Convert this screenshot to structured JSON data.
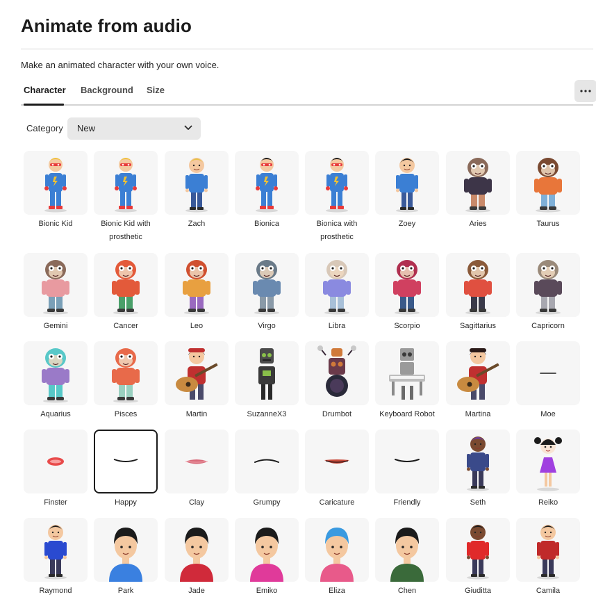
{
  "header": {
    "title": "Animate from audio",
    "subtitle": "Make an animated character with your own voice."
  },
  "tabs": [
    {
      "label": "Character",
      "selected": true
    },
    {
      "label": "Background",
      "selected": false
    },
    {
      "label": "Size",
      "selected": false
    }
  ],
  "more_icon": "ellipsis-icon",
  "category": {
    "label": "Category",
    "value": "New",
    "icon": "chevron-down-icon"
  },
  "characters": [
    {
      "name": "Bionic Kid",
      "kind": "hero",
      "colors": {
        "main": "#3b7fd4",
        "accent": "#e83a3a",
        "hair": "#f0c23a"
      }
    },
    {
      "name": "Bionic Kid with prosthetic",
      "kind": "hero",
      "colors": {
        "main": "#3b7fd4",
        "accent": "#e83a3a",
        "hair": "#f0c23a"
      }
    },
    {
      "name": "Zach",
      "kind": "person",
      "colors": {
        "main": "#3b7fd4",
        "accent": "#f2c230",
        "hair": "#e8c04a"
      }
    },
    {
      "name": "Bionica",
      "kind": "hero",
      "colors": {
        "main": "#3b7fd4",
        "accent": "#e83a3a",
        "hair": "#1b1b1b"
      }
    },
    {
      "name": "Bionica with prosthetic",
      "kind": "hero",
      "colors": {
        "main": "#3b7fd4",
        "accent": "#e83a3a",
        "hair": "#1b1b1b"
      }
    },
    {
      "name": "Zoey",
      "kind": "person",
      "colors": {
        "main": "#3b7fd4",
        "accent": "#f2c230",
        "hair": "#1b1b1b"
      }
    },
    {
      "name": "Aries",
      "kind": "creature",
      "colors": {
        "main": "#3d3548",
        "accent": "#c98a6a",
        "hair": "#8a6a5a"
      }
    },
    {
      "name": "Taurus",
      "kind": "creature",
      "colors": {
        "main": "#e8763a",
        "accent": "#7fb0d8",
        "hair": "#7a4a32"
      }
    },
    {
      "name": "Gemini",
      "kind": "creature",
      "colors": {
        "main": "#e89aa0",
        "accent": "#7aa0b8",
        "hair": "#8a6a5a"
      }
    },
    {
      "name": "Cancer",
      "kind": "creature",
      "colors": {
        "main": "#e35a3a",
        "accent": "#4aa06a",
        "hair": "#e35a3a"
      }
    },
    {
      "name": "Leo",
      "kind": "creature",
      "colors": {
        "main": "#e8a040",
        "accent": "#9a6ac0",
        "hair": "#d05030"
      }
    },
    {
      "name": "Virgo",
      "kind": "creature",
      "colors": {
        "main": "#6a8ab0",
        "accent": "#8a9aa8",
        "hair": "#6a7a88"
      }
    },
    {
      "name": "Libra",
      "kind": "creature",
      "colors": {
        "main": "#8a8ae0",
        "accent": "#a8c0d8",
        "hair": "#d8c8b8"
      }
    },
    {
      "name": "Scorpio",
      "kind": "creature",
      "colors": {
        "main": "#d04060",
        "accent": "#3a5a8a",
        "hair": "#b03050"
      }
    },
    {
      "name": "Sagittarius",
      "kind": "creature",
      "colors": {
        "main": "#e05040",
        "accent": "#3a3a4a",
        "hair": "#8a5a3a"
      }
    },
    {
      "name": "Capricorn",
      "kind": "creature",
      "colors": {
        "main": "#5a4a5a",
        "accent": "#a8a8b0",
        "hair": "#9a8a7a"
      }
    },
    {
      "name": "Aquarius",
      "kind": "creature",
      "colors": {
        "main": "#9a7ac8",
        "accent": "#58c8c8",
        "hair": "#58c8c8"
      }
    },
    {
      "name": "Pisces",
      "kind": "creature",
      "colors": {
        "main": "#e86a4a",
        "accent": "#9ad0c0",
        "hair": "#e86a4a"
      }
    },
    {
      "name": "Martin",
      "kind": "guitar",
      "colors": {
        "main": "#c03030",
        "accent": "#c88a40",
        "hair": "#3a2a20"
      }
    },
    {
      "name": "SuzanneX3",
      "kind": "robot",
      "colors": {
        "main": "#3a3a3a",
        "accent": "#8ac04a",
        "hair": "#2a2a2a"
      }
    },
    {
      "name": "Drumbot",
      "kind": "drumbot",
      "colors": {
        "main": "#6a3a4a",
        "accent": "#d07a3a",
        "hair": "#3a2a3a"
      }
    },
    {
      "name": "Keyboard Robot",
      "kind": "keyboardbot",
      "colors": {
        "main": "#9a9a9a",
        "accent": "#6a6a6a",
        "hair": "#5a5a5a"
      }
    },
    {
      "name": "Martina",
      "kind": "guitar",
      "colors": {
        "main": "#c03030",
        "accent": "#c88a40",
        "hair": "#2a1a18"
      }
    },
    {
      "name": "Moe",
      "kind": "mouth-flat",
      "colors": {
        "main": "#1b1b1b",
        "accent": "#1b1b1b",
        "hair": "#1b1b1b"
      }
    },
    {
      "name": "Finster",
      "kind": "mouth-red",
      "colors": {
        "main": "#e84a4a",
        "accent": "#f8a0a0",
        "hair": "#e84a4a"
      }
    },
    {
      "name": "Happy",
      "kind": "mouth-smile",
      "colors": {
        "main": "#1b1b1b",
        "accent": "#1b1b1b",
        "hair": "#1b1b1b"
      },
      "selected": true
    },
    {
      "name": "Clay",
      "kind": "mouth-lips",
      "colors": {
        "main": "#d86a7a",
        "accent": "#f0a8b0",
        "hair": "#d86a7a"
      }
    },
    {
      "name": "Grumpy",
      "kind": "mouth-frown",
      "colors": {
        "main": "#1b1b1b",
        "accent": "#1b1b1b",
        "hair": "#1b1b1b"
      }
    },
    {
      "name": "Caricature",
      "kind": "mouth-caricature",
      "colors": {
        "main": "#c84a3a",
        "accent": "#3a1a1a",
        "hair": "#c84a3a"
      }
    },
    {
      "name": "Friendly",
      "kind": "mouth-smile",
      "colors": {
        "main": "#1b1b1b",
        "accent": "#1b1b1b",
        "hair": "#1b1b1b"
      }
    },
    {
      "name": "Seth",
      "kind": "person",
      "colors": {
        "main": "#3a4a8a",
        "accent": "#5a5a9a",
        "hair": "#6a3ab0",
        "skin": "#7a4a30"
      }
    },
    {
      "name": "Reiko",
      "kind": "girl",
      "colors": {
        "main": "#a040e0",
        "accent": "#f4f4f4",
        "hair": "#1b1b1b"
      }
    },
    {
      "name": "Raymond",
      "kind": "person",
      "colors": {
        "main": "#2a4ad0",
        "accent": "#5ad05a",
        "hair": "#1b1b1b"
      }
    },
    {
      "name": "Park",
      "kind": "bust",
      "colors": {
        "main": "#3a80e0",
        "accent": "#3a80e0",
        "hair": "#1b1b1b"
      }
    },
    {
      "name": "Jade",
      "kind": "bust",
      "colors": {
        "main": "#d02a3a",
        "accent": "#2a2a2a",
        "hair": "#1b1b1b"
      }
    },
    {
      "name": "Emiko",
      "kind": "bust",
      "colors": {
        "main": "#e03a9a",
        "accent": "#f4f4f4",
        "hair": "#1b1b1b"
      }
    },
    {
      "name": "Eliza",
      "kind": "bust",
      "colors": {
        "main": "#e85a8a",
        "accent": "#f4f4f4",
        "hair": "#3a9ae0"
      }
    },
    {
      "name": "Chen",
      "kind": "bust",
      "colors": {
        "main": "#3a6a3a",
        "accent": "#6a9a5a",
        "hair": "#1b1b1b"
      }
    },
    {
      "name": "Giuditta",
      "kind": "person",
      "colors": {
        "main": "#e02a2a",
        "accent": "#e02a2a",
        "hair": "#1b1b1b",
        "skin": "#7a4a30"
      }
    },
    {
      "name": "Camila",
      "kind": "person",
      "colors": {
        "main": "#c02a2a",
        "accent": "#2a2a2a",
        "hair": "#1b1b1b"
      }
    }
  ]
}
